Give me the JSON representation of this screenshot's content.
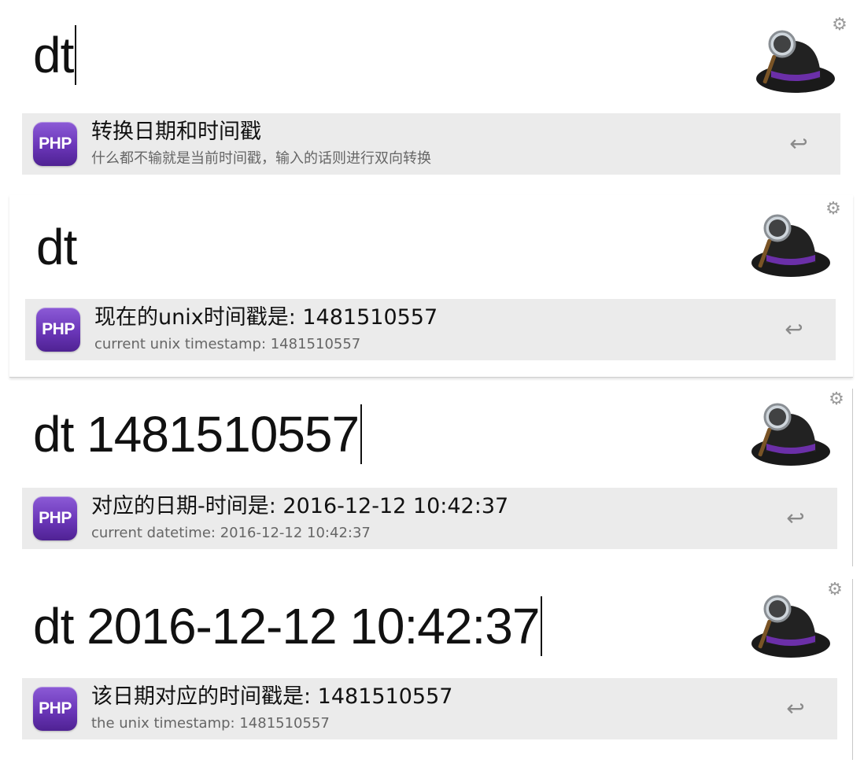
{
  "panels": [
    {
      "query": "dt",
      "result": {
        "icon": "PHP",
        "title": "转换日期和时间戳",
        "subtitle": "什么都不输就是当前时间戳，输入的话则进行双向转换"
      }
    },
    {
      "query": "dt",
      "result": {
        "icon": "PHP",
        "title": "现在的unix时间戳是: 1481510557",
        "subtitle": "current unix timestamp: 1481510557"
      }
    },
    {
      "query": "dt 1481510557",
      "result": {
        "icon": "PHP",
        "title": "对应的日期-时间是: 2016-12-12 10:42:37",
        "subtitle": "current datetime: 2016-12-12 10:42:37"
      }
    },
    {
      "query": "dt 2016-12-12 10:42:37",
      "result": {
        "icon": "PHP",
        "title": "该日期对应的时间戳是: 1481510557",
        "subtitle": "the unix timestamp: 1481510557"
      }
    }
  ],
  "icons": {
    "settings": "gear-icon",
    "app_logo": "alfred-hat-icon",
    "action": "return-icon",
    "workflow": "php-icon"
  },
  "colors": {
    "result_bg": "#ebebeb",
    "php_purple": "#6a36b8",
    "hat_band": "#6b2fa8"
  }
}
